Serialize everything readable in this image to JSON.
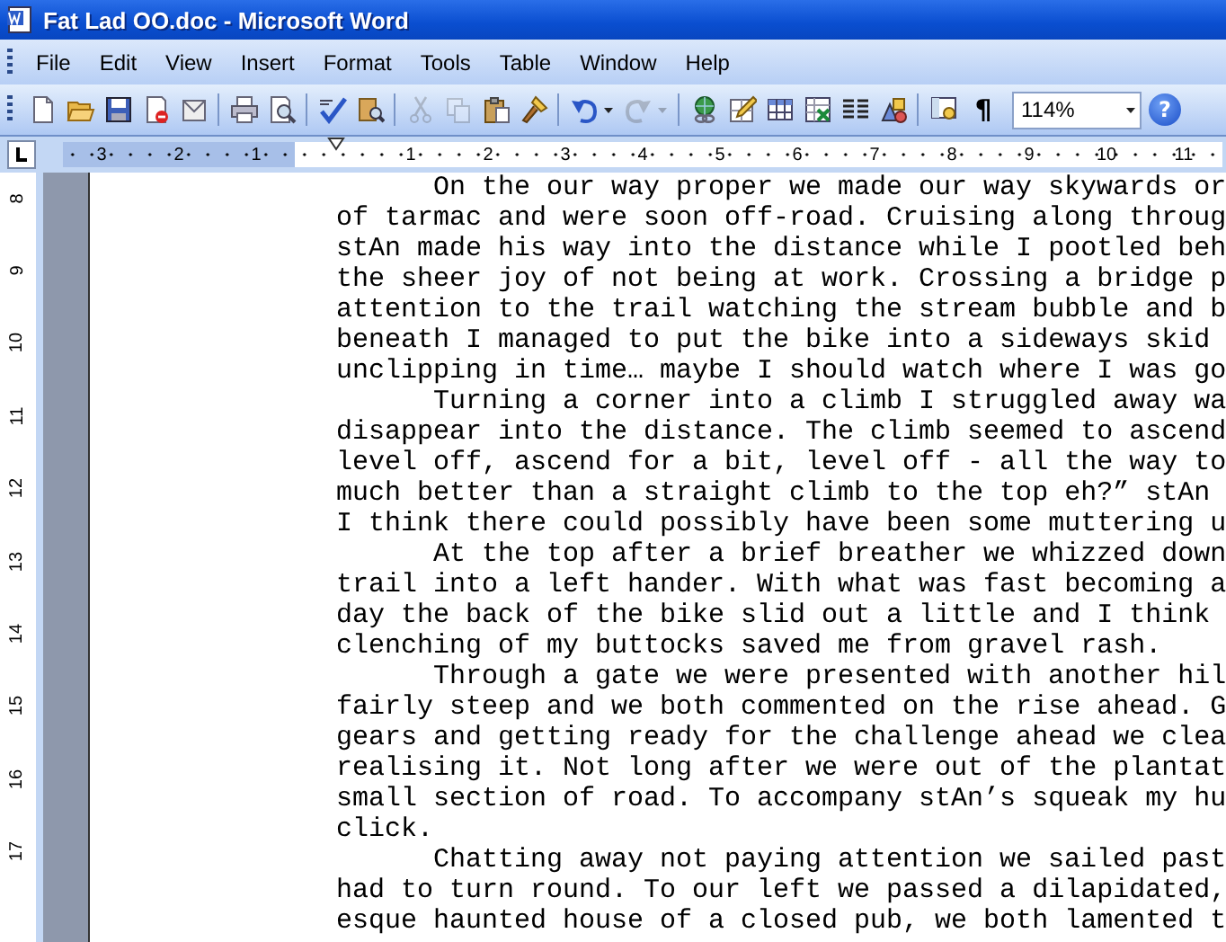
{
  "window": {
    "title": "Fat Lad OO.doc - Microsoft Word"
  },
  "menu": [
    "File",
    "Edit",
    "View",
    "Insert",
    "Format",
    "Tools",
    "Table",
    "Window",
    "Help"
  ],
  "toolbar": {
    "items": [
      {
        "kind": "new",
        "disabled": false
      },
      {
        "kind": "open",
        "disabled": false
      },
      {
        "kind": "save",
        "disabled": false
      },
      {
        "kind": "permission",
        "disabled": false
      },
      {
        "kind": "email",
        "disabled": false
      },
      {
        "kind": "separator"
      },
      {
        "kind": "print",
        "disabled": false
      },
      {
        "kind": "preview",
        "disabled": false
      },
      {
        "kind": "separator"
      },
      {
        "kind": "spelling",
        "disabled": false
      },
      {
        "kind": "research",
        "disabled": false
      },
      {
        "kind": "separator"
      },
      {
        "kind": "cut",
        "disabled": true
      },
      {
        "kind": "copy",
        "disabled": true
      },
      {
        "kind": "paste",
        "disabled": false
      },
      {
        "kind": "painter",
        "disabled": false
      },
      {
        "kind": "separator"
      },
      {
        "kind": "undo",
        "disabled": false
      },
      {
        "kind": "dropdown",
        "disabled": false
      },
      {
        "kind": "redo",
        "disabled": true
      },
      {
        "kind": "dropdown",
        "disabled": true
      },
      {
        "kind": "separator"
      },
      {
        "kind": "hyperlink",
        "disabled": false
      },
      {
        "kind": "borders",
        "disabled": false
      },
      {
        "kind": "table",
        "disabled": false
      },
      {
        "kind": "excel",
        "disabled": false
      },
      {
        "kind": "columns",
        "disabled": false
      },
      {
        "kind": "drawing",
        "disabled": false
      },
      {
        "kind": "separator"
      },
      {
        "kind": "docmap",
        "disabled": false
      },
      {
        "kind": "text",
        "label": "¶",
        "disabled": false
      }
    ],
    "zoom": {
      "value": "114%"
    },
    "help": {
      "label": "?"
    }
  },
  "ruler": {
    "left_numbers": [
      "3",
      "2",
      "1"
    ],
    "numbers": [
      "1",
      "2",
      "3",
      "4",
      "5",
      "6",
      "7",
      "8",
      "9",
      "10",
      "11"
    ]
  },
  "vertical_ruler": {
    "numbers": [
      "8",
      "9",
      "10",
      "11",
      "12",
      "13",
      "14",
      "15",
      "16",
      "17"
    ]
  },
  "document": {
    "paragraphs": [
      {
        "lines": [
          "On the our way proper we made our way skywards or",
          "of tarmac and were soon off-road. Cruising along throug",
          "stAn made his way into the distance while I pootled beh",
          "the sheer joy of not being at work. Crossing a bridge p",
          "attention to the trail watching the stream bubble and b",
          "beneath I managed to put the bike into a sideways skid",
          "unclipping in time… maybe I should watch where I was go"
        ]
      },
      {
        "lines": [
          "Turning a corner into a climb I struggled away wa",
          "disappear into the distance. The climb seemed to ascend",
          "level off, ascend for a bit, level off - all the way to",
          "much better than a straight climb to the top eh?” stAn",
          "I think there could possibly have been some muttering u"
        ]
      },
      {
        "lines": [
          "At the top after a brief breather we whizzed down",
          "trail into a left hander. With what was fast becoming a",
          "day the back of the bike slid out a little and I think",
          "clenching of my buttocks saved me from gravel rash."
        ]
      },
      {
        "lines": [
          "Through a gate we were presented with another hil",
          "fairly steep and we both commented on the rise ahead. G",
          "gears and getting ready for the challenge ahead we clea",
          "realising it. Not long after we were out of the plantat",
          "small section of road. To accompany stAn’s squeak my hu",
          "click."
        ]
      },
      {
        "lines": [
          "Chatting away not paying attention we sailed past",
          "had to turn round. To our left we passed a dilapidated,",
          "esque haunted house of a closed pub, we both lamented t"
        ]
      }
    ]
  }
}
